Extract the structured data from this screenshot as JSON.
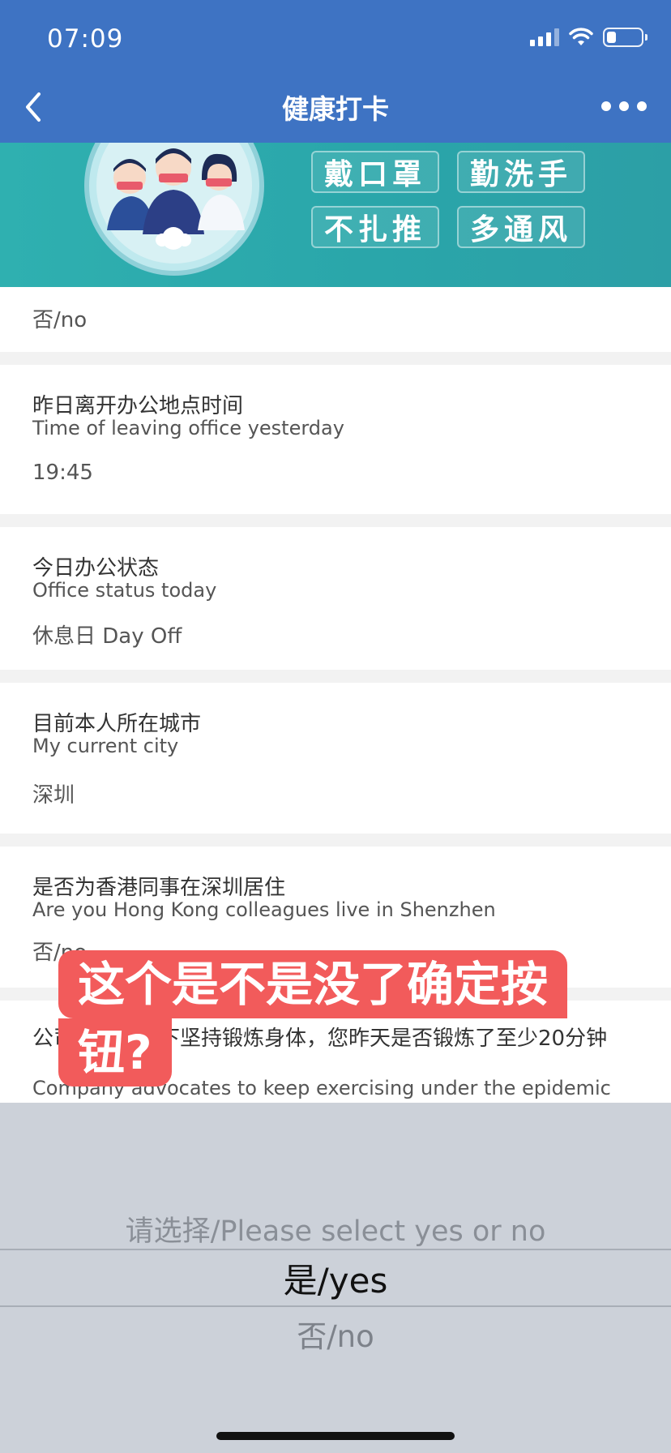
{
  "status": {
    "time": "07:09",
    "battery_level": 0.3
  },
  "nav": {
    "title": "健康打卡"
  },
  "banner": {
    "tags": [
      "戴口罩",
      "勤洗手",
      "不扎推",
      "多通风"
    ]
  },
  "form": {
    "top_answer": "否/no",
    "items": [
      {
        "q_cn": "昨日离开办公地点时间",
        "q_en": "Time of leaving office yesterday",
        "answer": "19:45"
      },
      {
        "q_cn": "今日办公状态",
        "q_en": "Office status today",
        "answer": "休息日 Day Off"
      },
      {
        "q_cn": "目前本人所在城市",
        "q_en": "My current city",
        "answer": "深圳"
      },
      {
        "q_cn": "是否为香港同事在深圳居住",
        "q_en": "Are you Hong Kong colleagues live in Shenzhen",
        "answer": "否/no"
      },
      {
        "q_cn": "公司倡导疫情下坚持锻炼身体，您昨天是否锻炼了至少20分钟",
        "q_en": "Company advocates to keep exercising under the epidemic"
      }
    ]
  },
  "picker": {
    "placeholder": "请选择/Please select yes or no",
    "selected": "是/yes",
    "other": "否/no"
  },
  "overlay": {
    "line1": "这个是不是没了确定按",
    "line2": "钮?"
  }
}
